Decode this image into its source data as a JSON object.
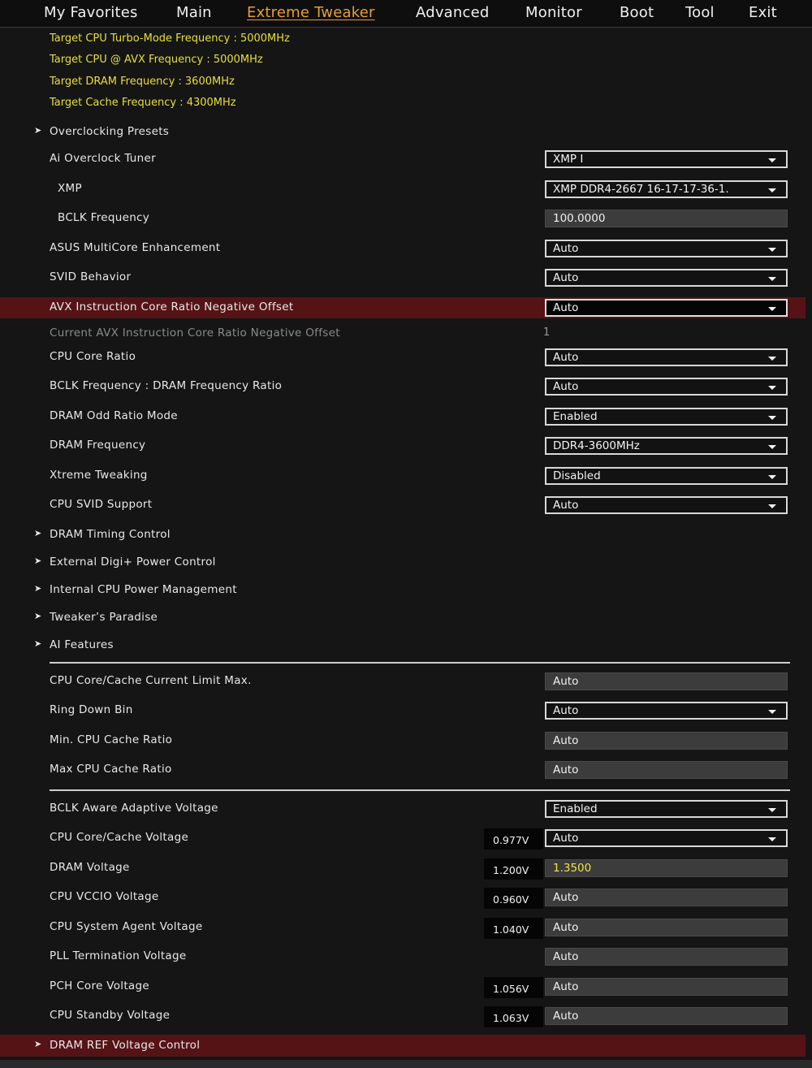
{
  "nav": {
    "tabs": [
      "My Favorites",
      "Main",
      "Extreme Tweaker",
      "Advanced",
      "Monitor",
      "Boot",
      "Tool",
      "Exit"
    ],
    "active_tab": "Extreme Tweaker"
  },
  "targets": [
    "Target CPU Turbo-Mode Frequency : 5000MHz",
    "Target CPU @ AVX Frequency : 5000MHz",
    "Target DRAM Frequency : 3600MHz",
    "Target Cache Frequency : 4300MHz"
  ],
  "menu": {
    "overclocking_presets": "Overclocking Presets",
    "ai_overclock_tuner": {
      "label": "Ai Overclock Tuner",
      "value": "XMP I"
    },
    "xmp": {
      "label": "XMP",
      "value": "XMP DDR4-2667 16-17-17-36-1."
    },
    "bclk_frequency": {
      "label": "BCLK Frequency",
      "value": "100.0000"
    },
    "multicore_enhancement": {
      "label": "ASUS MultiCore Enhancement",
      "value": "Auto"
    },
    "svid_behavior": {
      "label": "SVID Behavior",
      "value": "Auto"
    },
    "avx_offset": {
      "label": "AVX Instruction Core Ratio Negative Offset",
      "value": "Auto"
    },
    "current_avx_offset": {
      "label": "Current AVX Instruction Core Ratio Negative Offset",
      "value": "1"
    },
    "cpu_core_ratio": {
      "label": "CPU Core Ratio",
      "value": "Auto"
    },
    "bclk_dram_ratio": {
      "label": "BCLK Frequency : DRAM Frequency Ratio",
      "value": "Auto"
    },
    "dram_odd_ratio": {
      "label": "DRAM Odd Ratio Mode",
      "value": "Enabled"
    },
    "dram_frequency": {
      "label": "DRAM Frequency",
      "value": "DDR4-3600MHz"
    },
    "xtreme_tweaking": {
      "label": "Xtreme Tweaking",
      "value": "Disabled"
    },
    "cpu_svid_support": {
      "label": "CPU SVID Support",
      "value": "Auto"
    },
    "dram_timing_control": "DRAM Timing Control",
    "external_digi_power": "External Digi+ Power Control",
    "internal_cpu_power": "Internal CPU Power Management",
    "tweakers_paradise": "Tweaker’s Paradise",
    "ai_features": "AI Features",
    "core_cache_current_limit": {
      "label": "CPU Core/Cache Current Limit Max.",
      "value": "Auto"
    },
    "ring_down_bin": {
      "label": "Ring Down Bin",
      "value": "Auto"
    },
    "min_cache_ratio": {
      "label": "Min. CPU Cache Ratio",
      "value": "Auto"
    },
    "max_cache_ratio": {
      "label": "Max CPU Cache Ratio",
      "value": "Auto"
    },
    "bclk_aware_voltage": {
      "label": "BCLK Aware Adaptive Voltage",
      "value": "Enabled"
    },
    "core_cache_voltage": {
      "label": "CPU Core/Cache Voltage",
      "reading": "0.977V",
      "value": "Auto"
    },
    "dram_voltage": {
      "label": "DRAM Voltage",
      "reading": "1.200V",
      "value": "1.3500"
    },
    "vccio_voltage": {
      "label": "CPU VCCIO Voltage",
      "reading": "0.960V",
      "value": "Auto"
    },
    "system_agent_voltage": {
      "label": "CPU System Agent Voltage",
      "reading": "1.040V",
      "value": "Auto"
    },
    "pll_termination_voltage": {
      "label": "PLL Termination Voltage",
      "value": "Auto"
    },
    "pch_core_voltage": {
      "label": "PCH Core Voltage",
      "reading": "1.056V",
      "value": "Auto"
    },
    "cpu_standby_voltage": {
      "label": "CPU Standby Voltage",
      "reading": "1.063V",
      "value": "Auto"
    },
    "dram_ref_voltage_control": "DRAM REF Voltage Control"
  },
  "colors": {
    "active_tab": "#e8a02a",
    "target_text": "#e8df3a",
    "highlight_row": "#561316",
    "background": "#151515"
  }
}
